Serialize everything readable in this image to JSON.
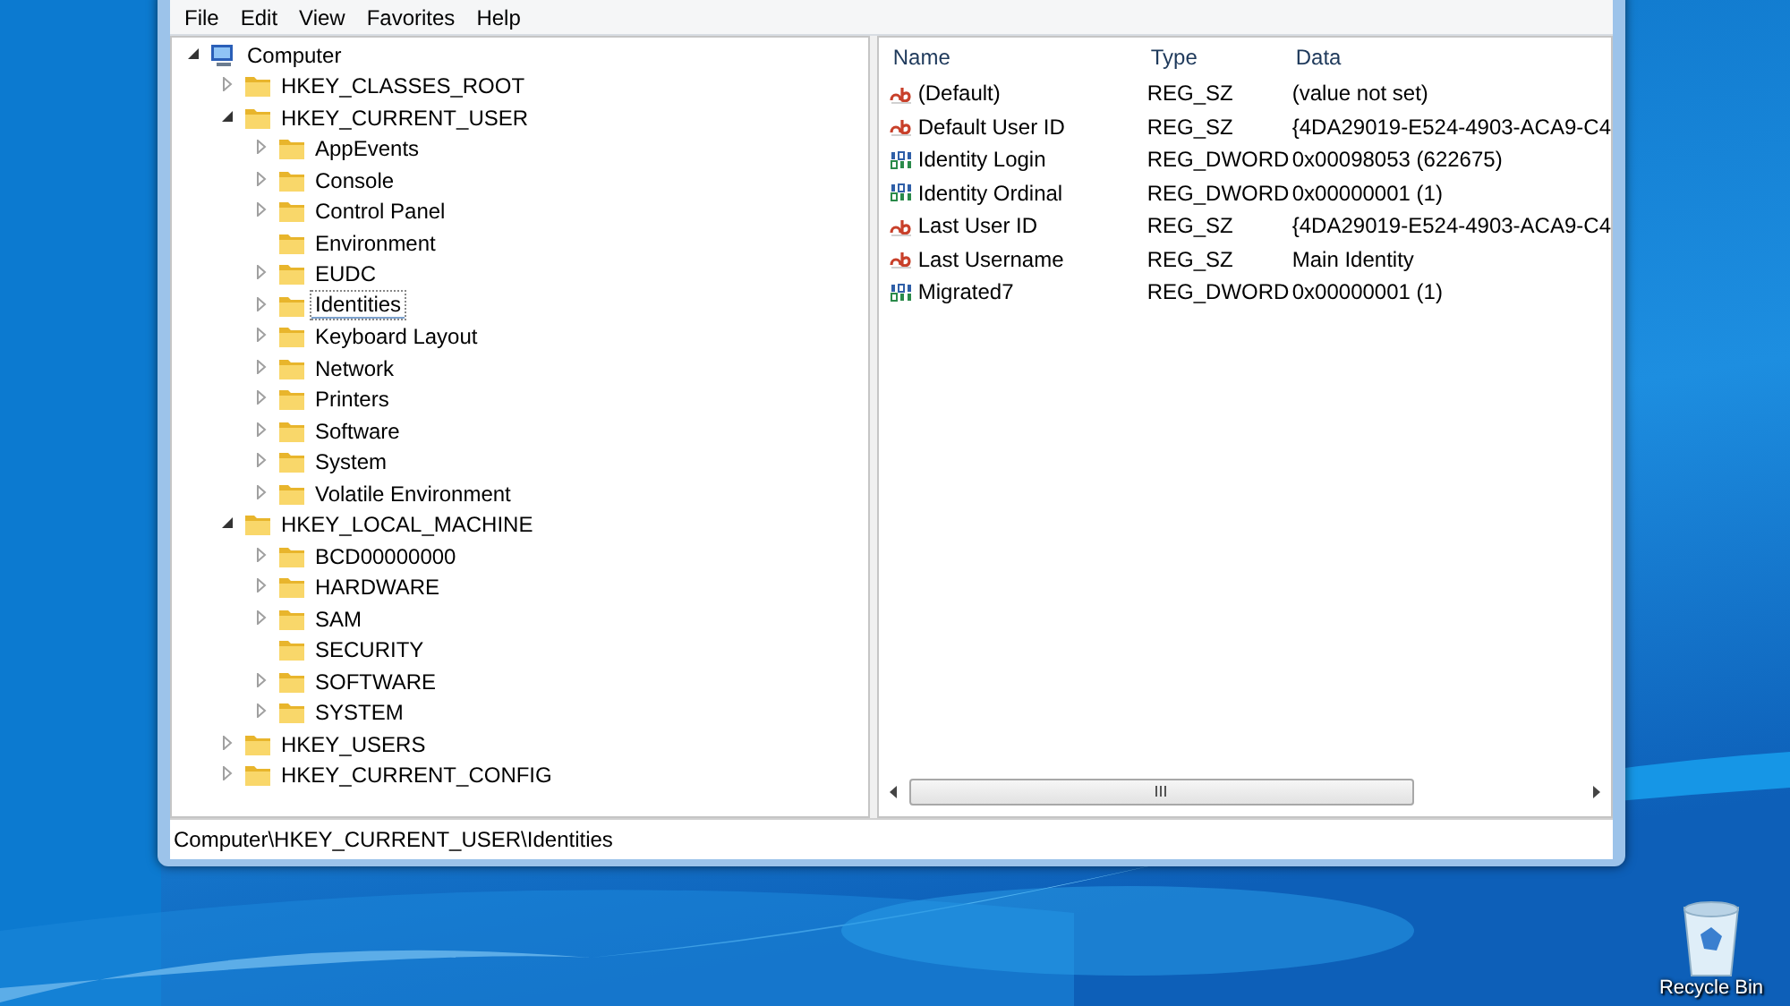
{
  "menu": [
    "File",
    "Edit",
    "View",
    "Favorites",
    "Help"
  ],
  "tree": [
    {
      "label": "Computer",
      "kind": "computer",
      "expanded": true,
      "selected": false,
      "children": [
        {
          "label": "HKEY_CLASSES_ROOT",
          "expanded": false,
          "selected": false
        },
        {
          "label": "HKEY_CURRENT_USER",
          "expanded": true,
          "selected": false,
          "children": [
            {
              "label": "AppEvents",
              "expanded": false,
              "selected": false
            },
            {
              "label": "Console",
              "expanded": false,
              "selected": false
            },
            {
              "label": "Control Panel",
              "expanded": false,
              "selected": false
            },
            {
              "label": "Environment",
              "selected": false
            },
            {
              "label": "EUDC",
              "expanded": false,
              "selected": false
            },
            {
              "label": "Identities",
              "expanded": false,
              "selected": true
            },
            {
              "label": "Keyboard Layout",
              "expanded": false,
              "selected": false
            },
            {
              "label": "Network",
              "expanded": false,
              "selected": false
            },
            {
              "label": "Printers",
              "expanded": false,
              "selected": false
            },
            {
              "label": "Software",
              "expanded": false,
              "selected": false
            },
            {
              "label": "System",
              "expanded": false,
              "selected": false
            },
            {
              "label": "Volatile Environment",
              "expanded": false,
              "selected": false
            }
          ]
        },
        {
          "label": "HKEY_LOCAL_MACHINE",
          "expanded": true,
          "selected": false,
          "children": [
            {
              "label": "BCD00000000",
              "expanded": false,
              "selected": false
            },
            {
              "label": "HARDWARE",
              "expanded": false,
              "selected": false
            },
            {
              "label": "SAM",
              "expanded": false,
              "selected": false
            },
            {
              "label": "SECURITY",
              "selected": false
            },
            {
              "label": "SOFTWARE",
              "expanded": false,
              "selected": false
            },
            {
              "label": "SYSTEM",
              "expanded": false,
              "selected": false
            }
          ]
        },
        {
          "label": "HKEY_USERS",
          "expanded": false,
          "selected": false
        },
        {
          "label": "HKEY_CURRENT_CONFIG",
          "expanded": false,
          "selected": false
        }
      ]
    }
  ],
  "values": {
    "columns": [
      "Name",
      "Type",
      "Data"
    ],
    "rows": [
      {
        "kind": "string",
        "name": "(Default)",
        "type": "REG_SZ",
        "data": "(value not set)"
      },
      {
        "kind": "string",
        "name": "Default User ID",
        "type": "REG_SZ",
        "data": "{4DA29019-E524-4903-ACA9-C4"
      },
      {
        "kind": "dword",
        "name": "Identity Login",
        "type": "REG_DWORD",
        "data": "0x00098053 (622675)"
      },
      {
        "kind": "dword",
        "name": "Identity Ordinal",
        "type": "REG_DWORD",
        "data": "0x00000001 (1)"
      },
      {
        "kind": "string",
        "name": "Last User ID",
        "type": "REG_SZ",
        "data": "{4DA29019-E524-4903-ACA9-C4"
      },
      {
        "kind": "string",
        "name": "Last Username",
        "type": "REG_SZ",
        "data": "Main Identity"
      },
      {
        "kind": "dword",
        "name": "Migrated7",
        "type": "REG_DWORD",
        "data": "0x00000001 (1)"
      }
    ]
  },
  "status_bar": "Computer\\HKEY_CURRENT_USER\\Identities",
  "desktop_icons": [
    {
      "label": "Recycle Bin"
    }
  ]
}
